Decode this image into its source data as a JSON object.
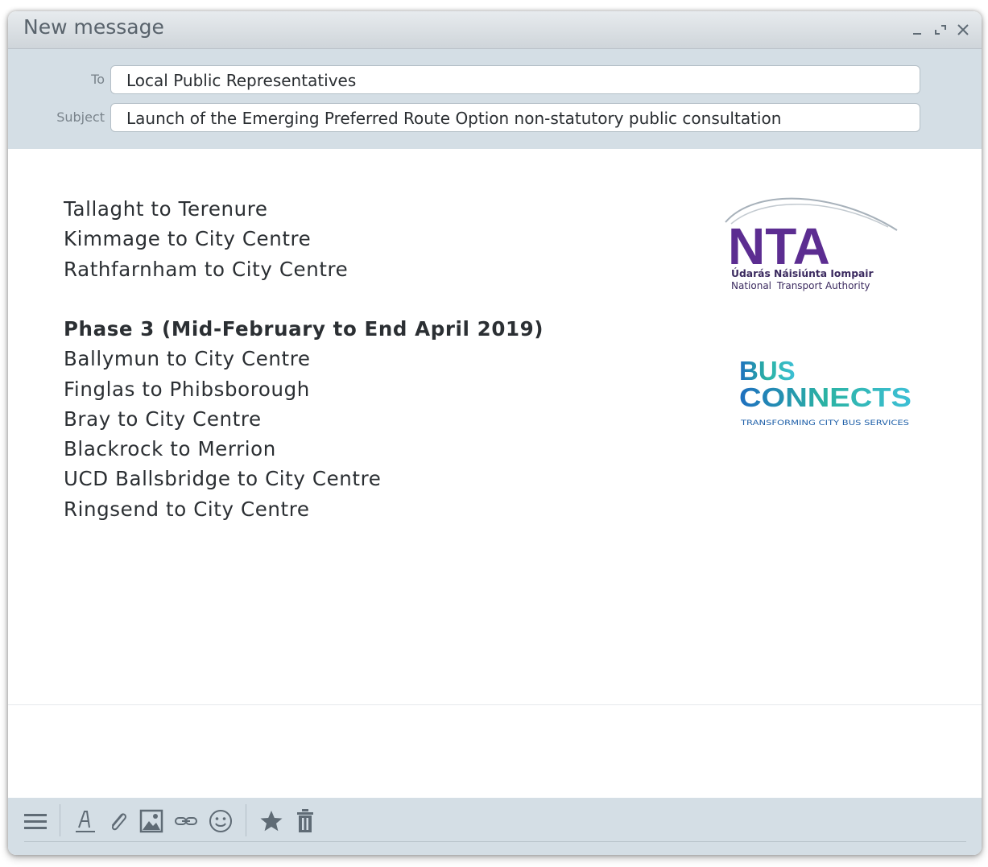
{
  "window": {
    "title": "New message",
    "controls": [
      "minimize-icon",
      "expand-icon",
      "close-icon"
    ]
  },
  "compose": {
    "to_label": "To",
    "to_value": "Local Public Representatives",
    "subject_label": "Subject",
    "subject_value": "Launch of the Emerging Preferred Route Option non-statutory public consultation"
  },
  "body": {
    "lines_group1": [
      "Tallaght to Terenure",
      "Kimmage to City Centre",
      "Rathfarnham to City Centre"
    ],
    "phase3_heading": "Phase 3 (Mid-February to End April 2019)",
    "lines_group2": [
      "Ballymun to City Centre",
      "Finglas to Phibsborough",
      "Bray to City Centre",
      "Blackrock to Merrion",
      "UCD Ballsbridge to City Centre",
      "Ringsend to City Centre"
    ]
  },
  "logos": {
    "nta": {
      "mark": "NTA",
      "irish_name": "Údarás Náisiúnta Iompair",
      "english_name_part1": "National",
      "english_name_part2": "Transport Authority",
      "color": "#5c2d91"
    },
    "busconnects": {
      "word1": "BUS",
      "word2": "CONNECTS",
      "tagline": "TRANSFORMING CITY BUS SERVICES",
      "colors": [
        "#1e6fbf",
        "#2bb3a3",
        "#3dbfd6"
      ]
    }
  },
  "toolbar": {
    "icons": [
      "menu-icon",
      "text-format-icon",
      "attachment-icon",
      "image-icon",
      "link-icon",
      "emoji-icon",
      "star-icon",
      "trash-icon"
    ]
  },
  "colors": {
    "header_bg": "#d4dee5",
    "icon_color": "#5f6b75",
    "text_color": "#2b2f33"
  }
}
